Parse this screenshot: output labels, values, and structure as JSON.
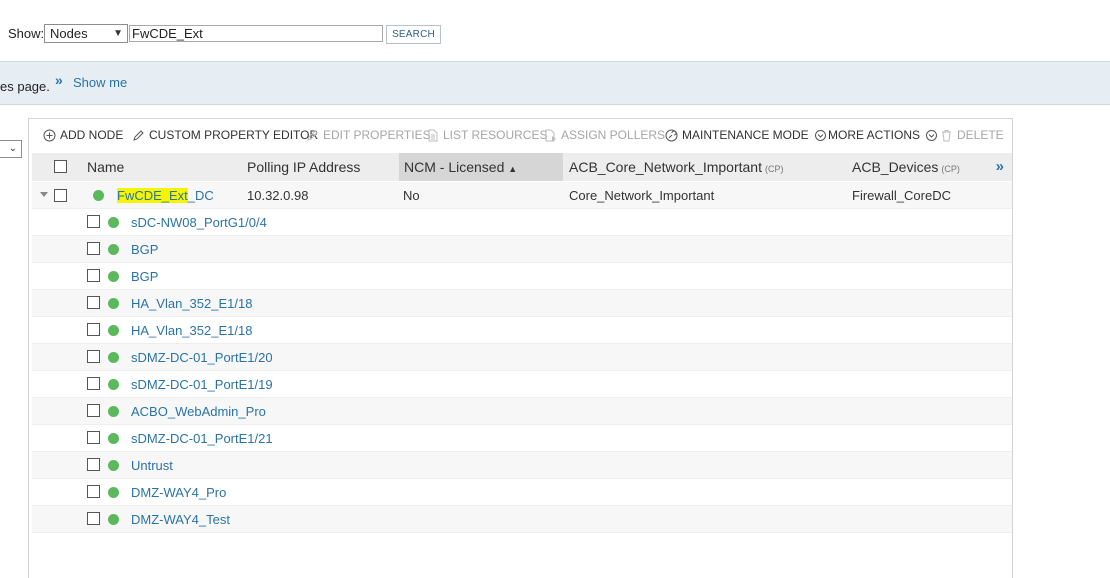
{
  "search": {
    "show_label": "Show:",
    "show_value": "Nodes",
    "query": "FwCDE_Ext",
    "button": "SEARCH"
  },
  "banner": {
    "text": "es page.",
    "link": "Show me"
  },
  "toolbar": {
    "add_node": "ADD NODE",
    "custom_property_editor": "CUSTOM PROPERTY EDITOR",
    "edit_properties": "EDIT PROPERTIES",
    "list_resources": "LIST RESOURCES",
    "assign_pollers": "ASSIGN POLLERS",
    "maintenance_mode": "MAINTENANCE MODE",
    "more_actions": "MORE ACTIONS",
    "delete": "DELETE"
  },
  "columns": {
    "name": "Name",
    "polling_ip": "Polling IP Address",
    "ncm": "NCM - Licensed",
    "acb_core": "ACB_Core_Network_Important",
    "acb_devices": "ACB_Devices",
    "cp": "(CP)",
    "more": "»"
  },
  "node": {
    "name_highlight": "FwCDE_Ext",
    "name_rest": "_DC",
    "ip": "10.32.0.98",
    "ncm": "No",
    "acb_core": "Core_Network_Important",
    "acb_devices": "Firewall_CoreDC",
    "status_color": "#5cb85c"
  },
  "interfaces": [
    {
      "name": "sDC-NW08_PortG1/0/4"
    },
    {
      "name": "BGP"
    },
    {
      "name": "BGP"
    },
    {
      "name": "HA_Vlan_352_E1/18"
    },
    {
      "name": "HA_Vlan_352_E1/18"
    },
    {
      "name": "sDMZ-DC-01_PortE1/20"
    },
    {
      "name": "sDMZ-DC-01_PortE1/19"
    },
    {
      "name": "ACBO_WebAdmin_Pro"
    },
    {
      "name": "sDMZ-DC-01_PortE1/21"
    },
    {
      "name": "Untrust"
    },
    {
      "name": "DMZ-WAY4_Pro"
    },
    {
      "name": "DMZ-WAY4_Test"
    }
  ],
  "colors": {
    "link": "#2a73a8",
    "status_up": "#5cb85c",
    "highlight": "#f5f500",
    "banner_bg": "#e6eef4"
  }
}
